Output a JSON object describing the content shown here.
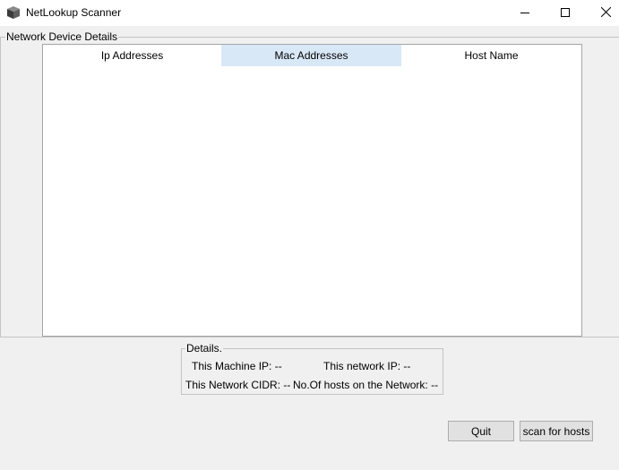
{
  "window": {
    "title": "NetLookup Scanner"
  },
  "device_group": {
    "legend": "Network Device Details"
  },
  "table": {
    "columns": [
      "Ip Addresses",
      "Mac Addresses",
      "Host Name"
    ],
    "rows": []
  },
  "details": {
    "legend": "Details.",
    "machine_ip": "This Machine IP: --",
    "network_ip": "This network IP: --",
    "network_cidr": "This Network CIDR: --",
    "hosts_count": "No.Of hosts on the Network: --"
  },
  "buttons": {
    "quit": "Quit",
    "scan": "scan for hosts"
  }
}
